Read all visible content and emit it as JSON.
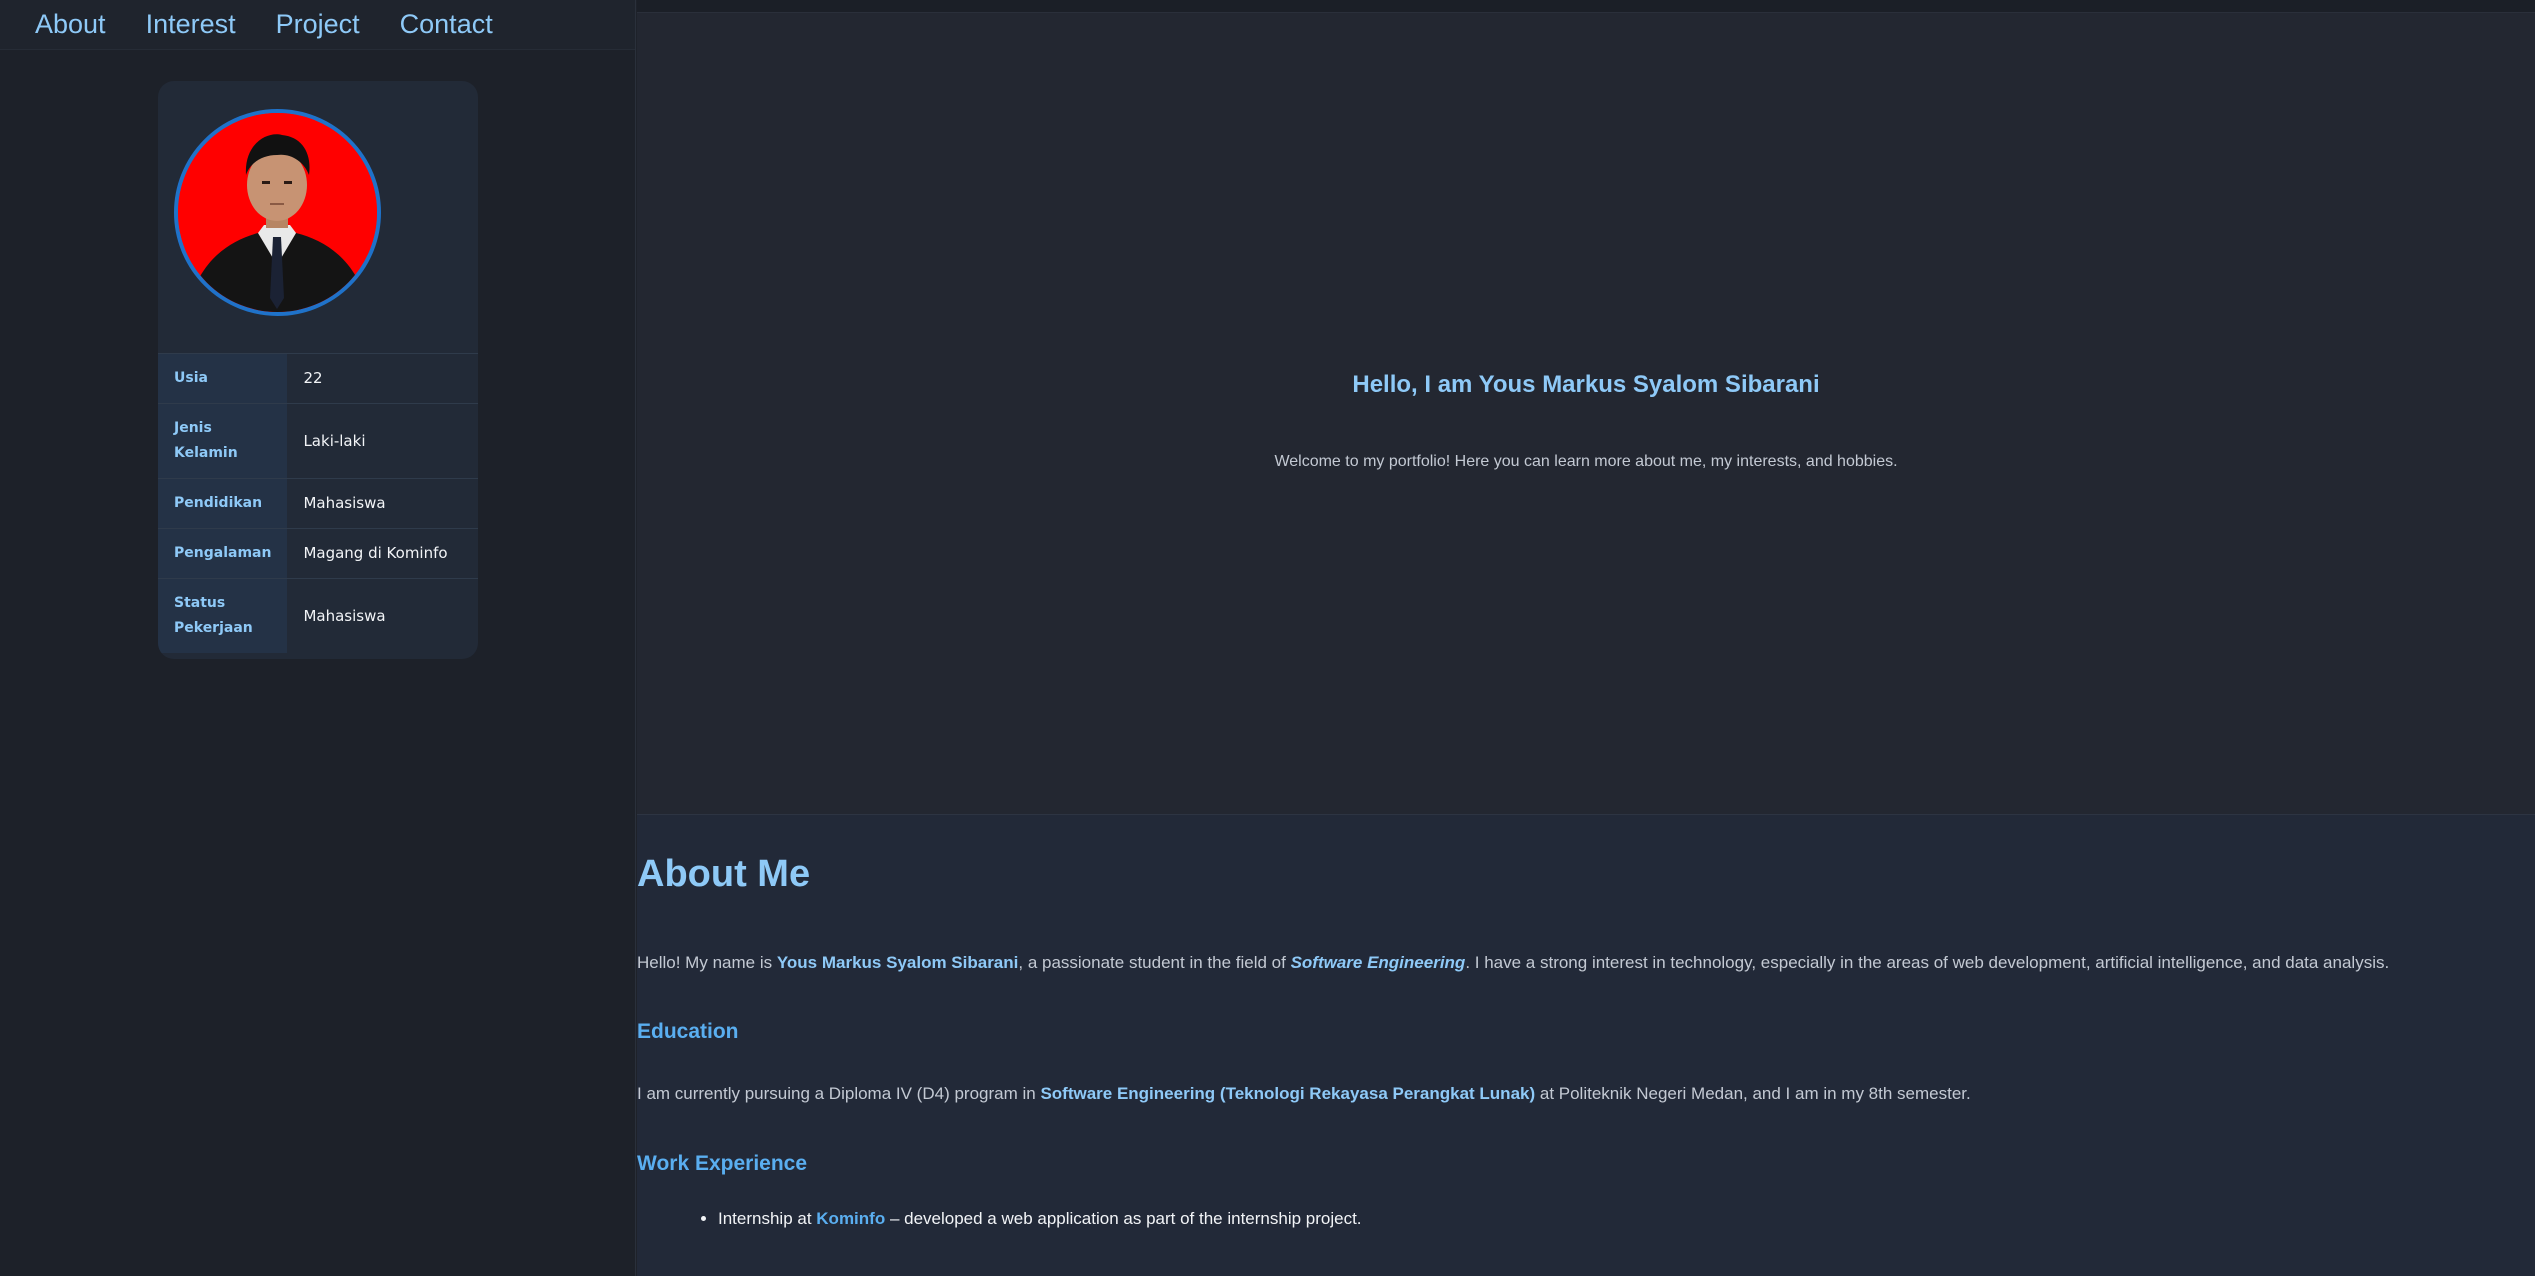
{
  "nav": {
    "items": [
      "About",
      "Interest",
      "Project",
      "Contact"
    ]
  },
  "profile": {
    "rows": [
      {
        "label": "Usia",
        "value": "22"
      },
      {
        "label": "Jenis Kelamin",
        "value": "Laki-laki"
      },
      {
        "label": "Pendidikan",
        "value": "Mahasiswa"
      },
      {
        "label": "Pengalaman",
        "value": "Magang di Kominfo"
      },
      {
        "label": "Status Pekerjaan",
        "value": "Mahasiswa"
      }
    ]
  },
  "hero": {
    "title": "Hello, I am Yous Markus Syalom Sibarani",
    "subtitle": "Welcome to my portfolio! Here you can learn more about me, my interests, and hobbies."
  },
  "about": {
    "heading": "About Me",
    "intro_prefix": "Hello! My name is ",
    "intro_name": "Yous Markus Syalom Sibarani",
    "intro_mid": ", a passionate student in the field of ",
    "intro_field": "Software Engineering",
    "intro_suffix": ". I have a strong interest in technology, especially in the areas of web development, artificial intelligence, and data analysis.",
    "education_heading": "Education",
    "edu_prefix": "I am currently pursuing a Diploma IV (D4) program in ",
    "edu_program": "Software Engineering (Teknologi Rekayasa Perangkat Lunak)",
    "edu_suffix": " at Politeknik Negeri Medan, and I am in my 8th semester.",
    "work_heading": "Work Experience",
    "work_prefix": "Internship at ",
    "work_company": "Kominfo",
    "work_suffix": " – developed a web application as part of the internship project."
  },
  "colors": {
    "accent": "#8ec9f7",
    "accent_strong": "#5aaef0",
    "avatar_bg": "#ff0000",
    "avatar_border": "#1f72c9"
  }
}
